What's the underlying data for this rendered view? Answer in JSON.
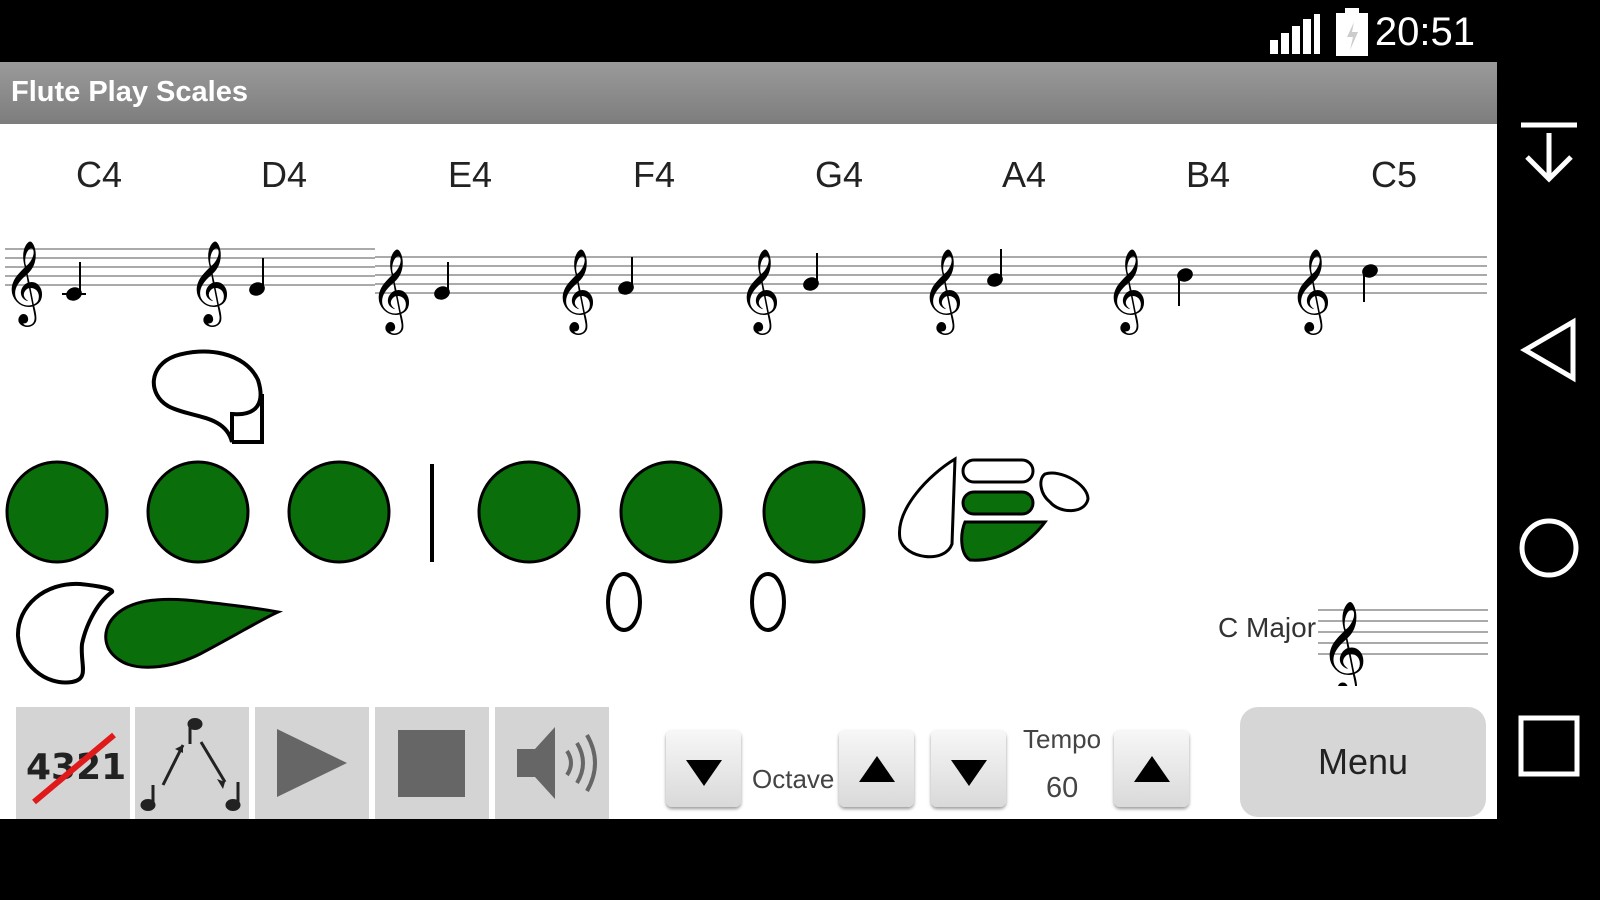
{
  "status": {
    "time": "20:51",
    "signal": "signal-icon",
    "battery": "battery-icon"
  },
  "app": {
    "title": "Flute Play Scales"
  },
  "scale": {
    "notes": [
      "C4",
      "D4",
      "E4",
      "F4",
      "G4",
      "A4",
      "B4",
      "C5"
    ],
    "key_label": "C Major"
  },
  "toolbar": {
    "fingering_label": "4321",
    "pattern": "arpeggio-pattern-icon",
    "play": "play-icon",
    "stop": "stop-icon",
    "sound": "speaker-icon"
  },
  "octave": {
    "label": "Octave"
  },
  "tempo": {
    "label": "Tempo",
    "value": "60"
  },
  "menu": {
    "label": "Menu"
  },
  "colors": {
    "key_pressed": "#0a6e0a",
    "titlebar": "#8a8a8a",
    "button": "#d4d4d4"
  },
  "nav": {
    "items": [
      "download-icon",
      "back-icon",
      "home-icon",
      "recents-icon"
    ]
  }
}
